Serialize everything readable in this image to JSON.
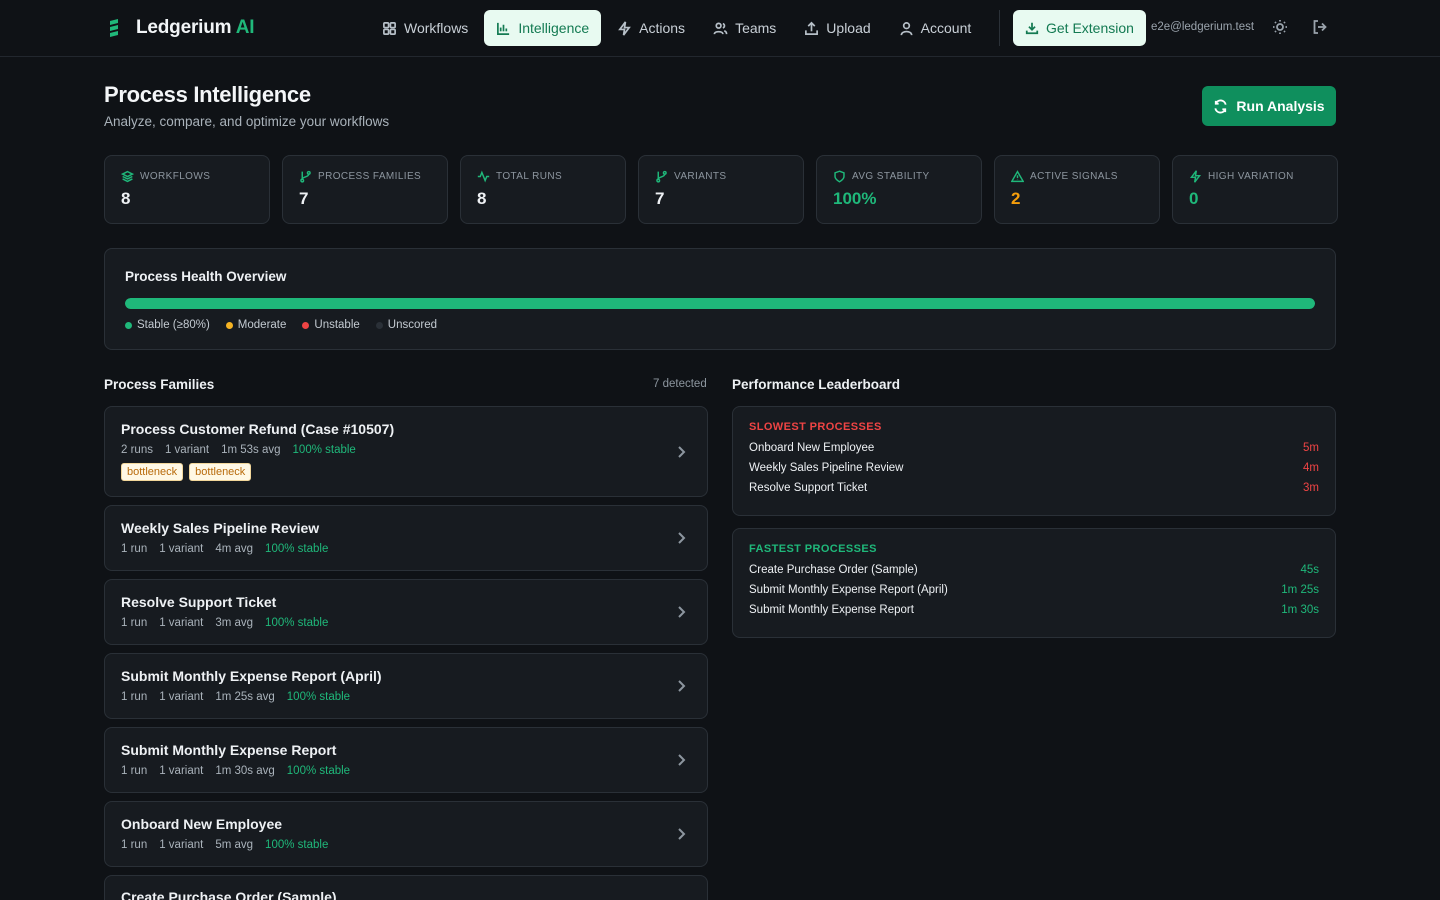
{
  "brand": {
    "name": "Ledgerium",
    "suffix": "AI"
  },
  "nav": {
    "items": [
      {
        "label": "Workflows",
        "icon": "grid-icon"
      },
      {
        "label": "Intelligence",
        "icon": "bar-chart-icon",
        "active": true
      },
      {
        "label": "Actions",
        "icon": "lightning-icon"
      },
      {
        "label": "Teams",
        "icon": "users-icon"
      },
      {
        "label": "Upload",
        "icon": "upload-icon"
      },
      {
        "label": "Account",
        "icon": "user-icon"
      }
    ],
    "extension_label": "Get Extension",
    "user_email": "e2e@ledgerium.test"
  },
  "header": {
    "title": "Process Intelligence",
    "subtitle": "Analyze, compare, and optimize your workflows",
    "run_label": "Run Analysis"
  },
  "stats": [
    {
      "label": "Workflows",
      "value": "8",
      "color": "#eef1f4",
      "icon_color": "#1fb87a"
    },
    {
      "label": "Process Families",
      "value": "7",
      "color": "#eef1f4",
      "icon_color": "#1fb87a"
    },
    {
      "label": "Total Runs",
      "value": "8",
      "color": "#eef1f4",
      "icon_color": "#1fb87a"
    },
    {
      "label": "Variants",
      "value": "7",
      "color": "#eef1f4",
      "icon_color": "#1fb87a"
    },
    {
      "label": "Avg Stability",
      "value": "100%",
      "color": "#1fb87a",
      "icon_color": "#1fb87a"
    },
    {
      "label": "Active Signals",
      "value": "2",
      "color": "#f59e0b",
      "icon_color": "#1fb87a"
    },
    {
      "label": "High Variation",
      "value": "0",
      "color": "#1fb87a",
      "icon_color": "#1fb87a"
    }
  ],
  "health": {
    "title": "Process Health Overview",
    "stable_fraction": 1.0,
    "legend": [
      {
        "label": "Stable (≥80%)",
        "color": "#1fb87a"
      },
      {
        "label": "Moderate",
        "color": "#f5b323"
      },
      {
        "label": "Unstable",
        "color": "#ef4444"
      },
      {
        "label": "Unscored",
        "color": "#2a3037"
      }
    ]
  },
  "families": {
    "title": "Process Families",
    "count_label": "7 detected",
    "items": [
      {
        "name": "Process Customer Refund (Case #10507)",
        "runs": "2 runs",
        "variants": "1 variant",
        "avg": "1m 53s avg",
        "stability": "100% stable",
        "tags": [
          "bottleneck",
          "bottleneck"
        ]
      },
      {
        "name": "Weekly Sales Pipeline Review",
        "runs": "1 run",
        "variants": "1 variant",
        "avg": "4m avg",
        "stability": "100% stable",
        "tags": []
      },
      {
        "name": "Resolve Support Ticket",
        "runs": "1 run",
        "variants": "1 variant",
        "avg": "3m avg",
        "stability": "100% stable",
        "tags": []
      },
      {
        "name": "Submit Monthly Expense Report (April)",
        "runs": "1 run",
        "variants": "1 variant",
        "avg": "1m 25s avg",
        "stability": "100% stable",
        "tags": []
      },
      {
        "name": "Submit Monthly Expense Report",
        "runs": "1 run",
        "variants": "1 variant",
        "avg": "1m 30s avg",
        "stability": "100% stable",
        "tags": []
      },
      {
        "name": "Onboard New Employee",
        "runs": "1 run",
        "variants": "1 variant",
        "avg": "5m avg",
        "stability": "100% stable",
        "tags": []
      },
      {
        "name": "Create Purchase Order (Sample)",
        "runs": "",
        "variants": "",
        "avg": "",
        "stability": "",
        "tags": []
      }
    ]
  },
  "leaderboard": {
    "title": "Performance Leaderboard",
    "slowest": {
      "title": "Slowest Processes",
      "rows": [
        {
          "name": "Onboard New Employee",
          "value": "5m"
        },
        {
          "name": "Weekly Sales Pipeline Review",
          "value": "4m"
        },
        {
          "name": "Resolve Support Ticket",
          "value": "3m"
        }
      ]
    },
    "fastest": {
      "title": "Fastest Processes",
      "rows": [
        {
          "name": "Create Purchase Order (Sample)",
          "value": "45s"
        },
        {
          "name": "Submit Monthly Expense Report (April)",
          "value": "1m 25s"
        },
        {
          "name": "Submit Monthly Expense Report",
          "value": "1m 30s"
        }
      ]
    }
  }
}
